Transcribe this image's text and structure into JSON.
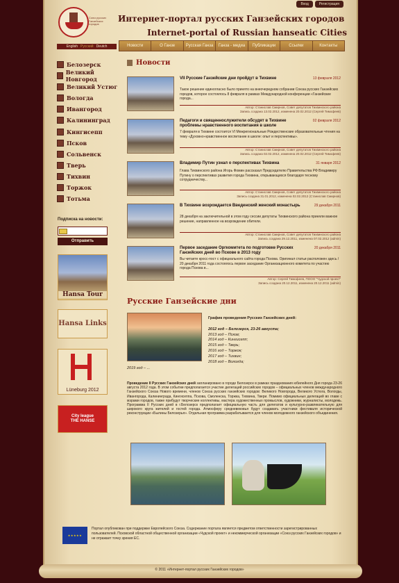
{
  "top_links": [
    "Вход",
    "Регистрация"
  ],
  "logo_text": "Союз русских Ганзейских городов",
  "site_title_ru": "Интернет-портал русских Ганзейских городов",
  "site_title_en": "Internet-portal of Russian hanseatic Cities",
  "languages": [
    {
      "label": "English",
      "active": false
    },
    {
      "label": "Русский",
      "active": true
    },
    {
      "label": "Deutch",
      "active": false
    }
  ],
  "nav": [
    "Новости",
    "О Ганзе",
    "Русская Ганза",
    "Ганза - медиа",
    "Публикации",
    "Ссылки",
    "Контакты"
  ],
  "cities": [
    "Белозерск",
    "Великий Новгород",
    "Великий Устюг",
    "Вологда",
    "Ивангород",
    "Калининград",
    "Кингисепп",
    "Псков",
    "Сольвенск",
    "Тверь",
    "Тихвин",
    "Торжок",
    "Тотьма"
  ],
  "subscribe": {
    "label": "Подписка на новости:",
    "button": "Отправить"
  },
  "banners": {
    "hansatour": "Hansa Tour",
    "hansalinks": "Hansa Links",
    "luneburg": "Lüneburg 2012",
    "thehanse_line1": "City league",
    "thehanse_line2": "THE HANSE"
  },
  "news_title": "Новости",
  "news": [
    {
      "title": "VII Русские Ганзейские дни пройдут в Тихвине",
      "date": "13 февраля 2012",
      "body": "Такое решение единогласно было принято на внеочередном собрании Союза русских Ганзейских городов, которое состоялось 8 февраля в рамках Международной конференции «Ганзейские города...",
      "author": "Автор: Станислав Смирнов, Совет депутатов Тихвинского района",
      "record": "Запись создана 13.02.2012, изменена 20.02.2012 (Сергей Тимофеев)"
    },
    {
      "title": "Педагоги и священнослужители обсудят в Тихвине проблемы нравственного воспитания в школе",
      "date": "02 февраля 2012",
      "body": "7 февраля в Тихвине состоится VI Межрегиональные Рождественские образовательные чтения на тему «Духовно-нравственное воспитание в школе: опыт и перспективы».",
      "author": "Автор: Станислав Смирнов, Совет депутатов Тихвинского района",
      "record": "Запись создана 02.02.2012, изменена 20.02.2012 (Сергей Тимофеев)"
    },
    {
      "title": "Владимир Путин узнал о перспективах Тихвина",
      "date": "31 января 2012",
      "body": "Глава Тихвинского района Игорь Фомин рассказал Председателю Правительства РФ Владимиру Путину о перспективах развития города Тихвина, открывающихся благодаря тесному сотрудничеству...",
      "author": "Автор: Станислав Смирнов, Совет депутатов Тихвинского района",
      "record": "Запись создана 31.01.2012, изменена 02.02.2012 (Станислав Смирнов)"
    },
    {
      "title": "В Тихвине возрождается Введенский женский монастырь",
      "date": "29 декабря 2011",
      "body": "28 декабря на заключительной в этом году сессии депутаты Тихвинского района приняли важное решение, направленное на возрождение обители.",
      "author": "Автор: Станислав Смирнов, Совет депутатов Тихвинского района",
      "record": "Запись создана 29.12.2011, изменена 07.02.2012 (admin)"
    },
    {
      "title": "Первое заседание Оргкомитета по подготовке Русских Ганзейских дней во Пскове в 2013 году",
      "date": "20 декабря 2011",
      "body": "Вы читаете кросс-пост с официального сайта города Пскова. Оригинал статьи расположен здесь / 20 декабря 2011 года состоялось первое заседание Организационного комитета по участию города Пскова в...",
      "author": "Автор: Сергей Тимофеев, ПООО \"Чудской проект\"",
      "record": "Запись создана 20.12.2011, изменена 20.12.2011 (admin)"
    }
  ],
  "days_title": "Русские Ганзейские дни",
  "schedule_header": "График проведения Русских Ганзейских дней:",
  "schedule": [
    "2012 год – Белозерск, 23-26 августа;",
    "2013 год – Псков;",
    "2014 год – Кингисепп;",
    "2015 год – Тверь;",
    "2016 год – Торжок;",
    "2017 год – Тихвин;",
    "2018 год – Вологда;"
  ],
  "schedule_last": "2019 год – ...",
  "days_text_lead": "Проведение II Русских Ганзейских дней",
  "days_text": " запланировано в городе Белозерск в рамках празднования юбилейного Дня города 23-26 августа 2012 года. В этом событии предполагается участие делегаций российских городов – официальных членов международного Ганзейского Союза Нового времени, членов Союза русских ганзейских городов: Великого Новгорода, Великого Устюга, Вологды, Ивангорода, Калининграда, Кингисеппа, Пскова, Смоленска, Торжка, Тихвина, Твери. Помимо официальных делегаций во главе с мэрами городов, также прибудут творческие коллективы, мастера художественных промыслов, художники, журналисты, молодежь. Программа II Русских дней в г.Белозерск предполагает официальную часть для делегатов и культурно-развлекательную для широкого круга жителей и гостей города. Атмосферу средневековья будут создавать участники фестиваля исторической реконструкции «Былины Белозерья». Отдельная программа разрабатывается для членов молодежного ганзейского объединения.",
  "footer_text": "Портал опубликован при поддержке Европейского Союза. Содержание портала является предметом ответственности зарегистрированных пользователей. Псковской областной общественной организации «Чудской проект» и некоммерческой организации «Союз русских Ганзейских городов» и не отражает точку зрения ЕС.",
  "copyright": "© 2011 «Интернет-портал русских Ганзейских городов»",
  "colors": {
    "background": "#3a0a0d",
    "accent": "#8a1a14",
    "nav": "#c99a4a"
  }
}
